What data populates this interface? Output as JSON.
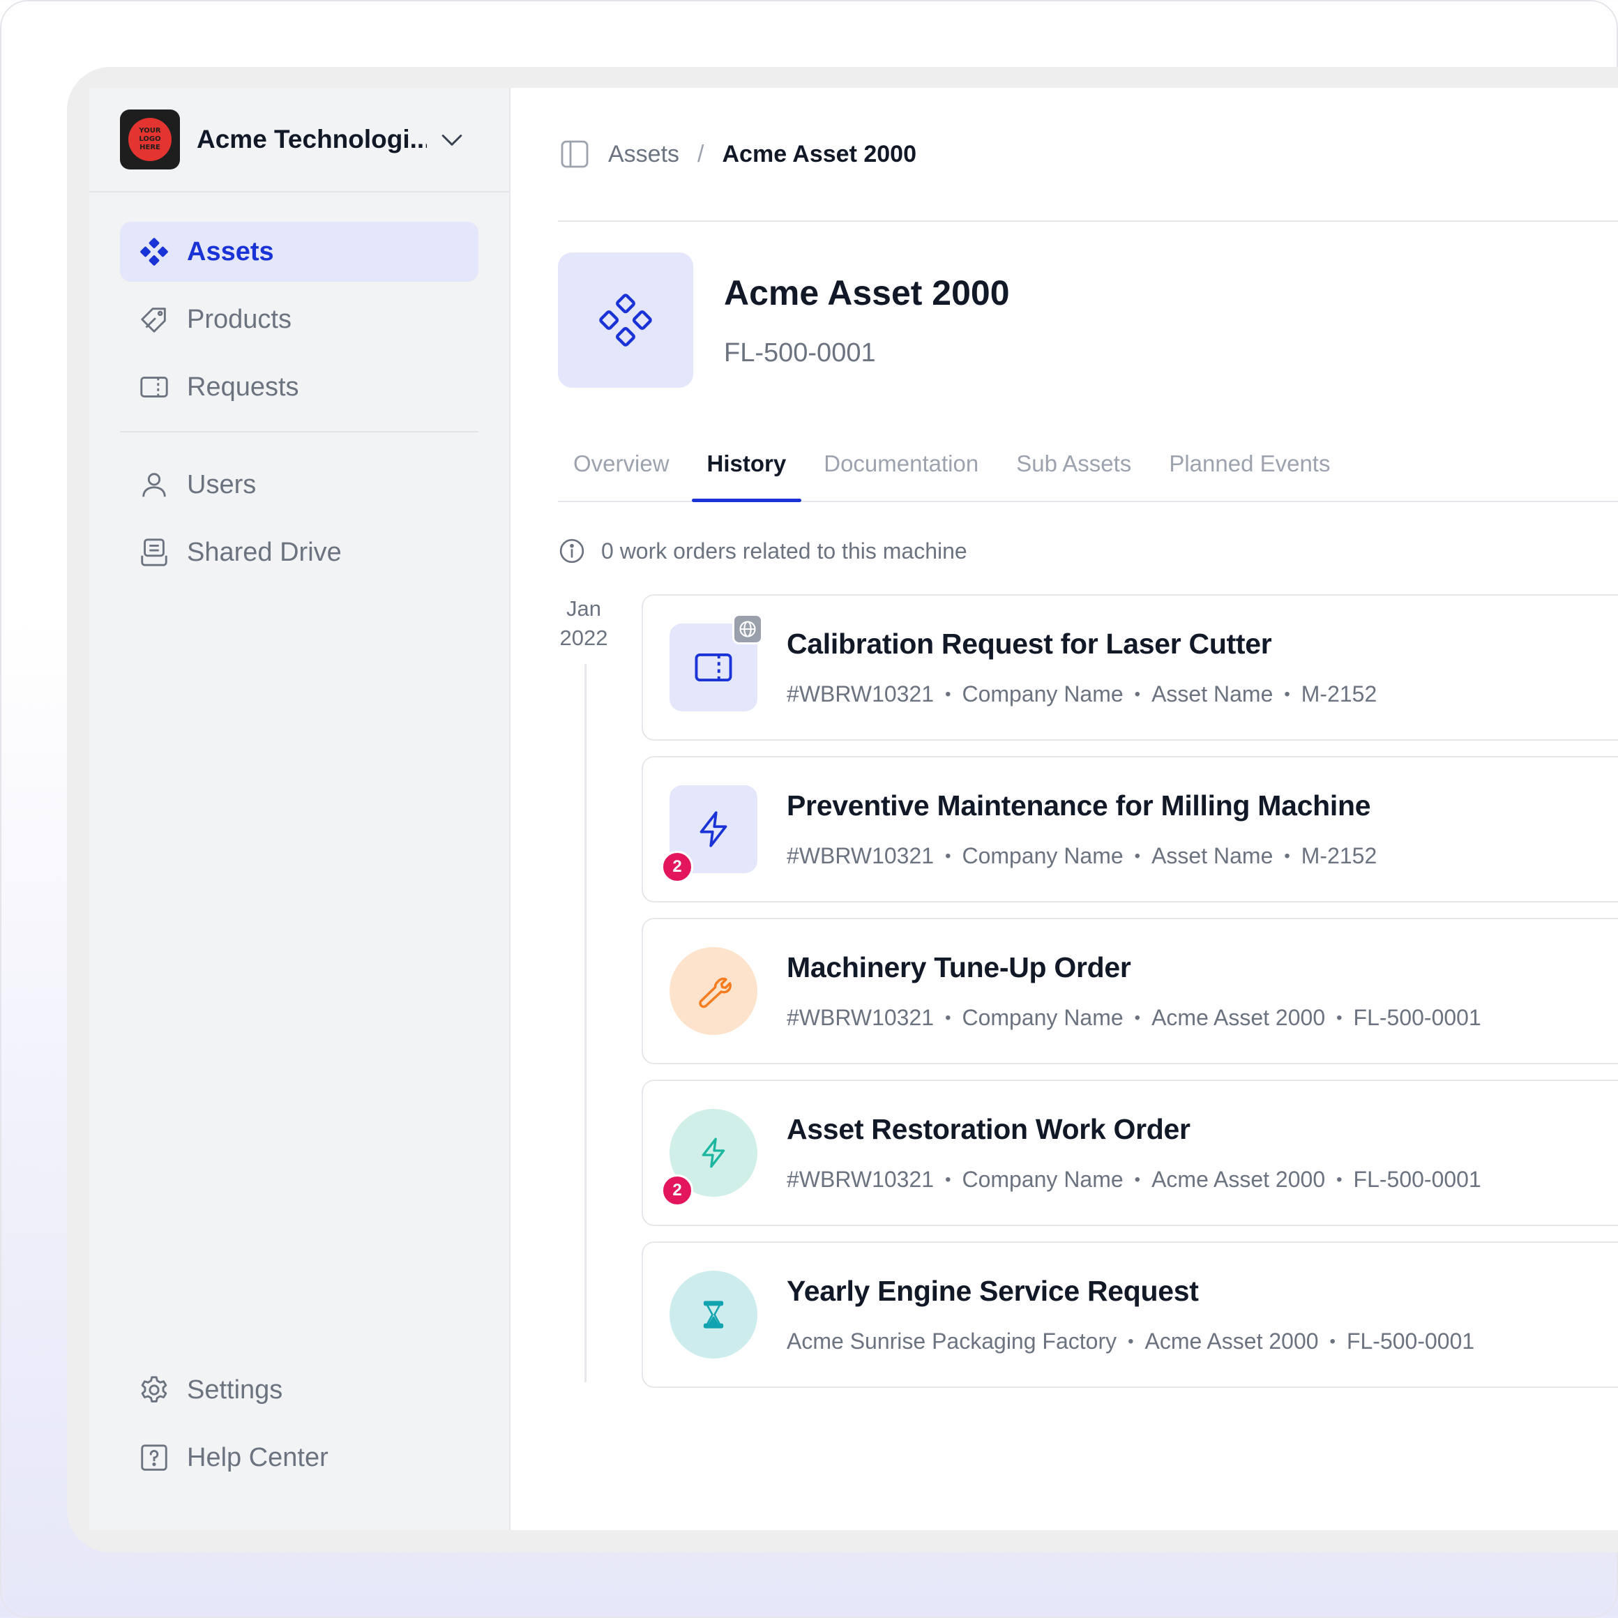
{
  "org": {
    "logo_text": "YOUR LOGO HERE",
    "name": "Acme Technologi..."
  },
  "sidebar": {
    "items": [
      {
        "label": "Assets",
        "icon": "assets-icon",
        "active": true
      },
      {
        "label": "Products",
        "icon": "tag-icon"
      },
      {
        "label": "Requests",
        "icon": "ticket-icon"
      }
    ],
    "secondary": [
      {
        "label": "Users",
        "icon": "user-icon"
      },
      {
        "label": "Shared Drive",
        "icon": "drive-icon"
      }
    ],
    "bottom": [
      {
        "label": "Settings",
        "icon": "gear-icon"
      },
      {
        "label": "Help Center",
        "icon": "help-icon"
      }
    ]
  },
  "breadcrumb": {
    "parent": "Assets",
    "separator": "/",
    "current": "Acme Asset 2000"
  },
  "asset": {
    "title": "Acme Asset 2000",
    "code": "FL-500-0001"
  },
  "tabs": [
    "Overview",
    "History",
    "Documentation",
    "Sub Assets",
    "Planned Events"
  ],
  "active_tab": "History",
  "info_text": "0 work orders related to this machine",
  "timeline": {
    "month": "Jan",
    "year": "2022"
  },
  "records": [
    {
      "title": "Calibration Request for Laser Cutter",
      "meta": [
        "#WBRW10321",
        "Company Name",
        "Asset Name",
        "M-2152"
      ],
      "icon": "ticket-icon"
    },
    {
      "title": "Preventive Maintenance for Milling Machine",
      "meta": [
        "#WBRW10321",
        "Company Name",
        "Asset Name",
        "M-2152"
      ],
      "icon": "lightning-icon",
      "badge": "2"
    },
    {
      "title": "Machinery Tune-Up Order",
      "meta": [
        "#WBRW10321",
        "Company Name",
        "Acme Asset 2000",
        "FL-500-0001"
      ],
      "icon": "wrench-icon"
    },
    {
      "title": "Asset Restoration Work Order",
      "meta": [
        "#WBRW10321",
        "Company Name",
        "Acme Asset 2000",
        "FL-500-0001"
      ],
      "icon": "lightning-icon",
      "badge": "2"
    },
    {
      "title": "Yearly Engine Service Request",
      "meta": [
        "Acme Sunrise Packaging Factory",
        "Acme Asset 2000",
        "FL-500-0001"
      ],
      "icon": "hourglass-icon"
    }
  ],
  "colors": {
    "accent": "#1a33d6",
    "accent_bg": "#e4e6fb",
    "badge": "#e3155c",
    "orange": "#f57c1f",
    "orange_bg": "#fde3cc",
    "green": "#1bb5a0",
    "green_bg": "#d0efe9",
    "teal": "#12a3b0",
    "teal_bg": "#cdecee"
  }
}
